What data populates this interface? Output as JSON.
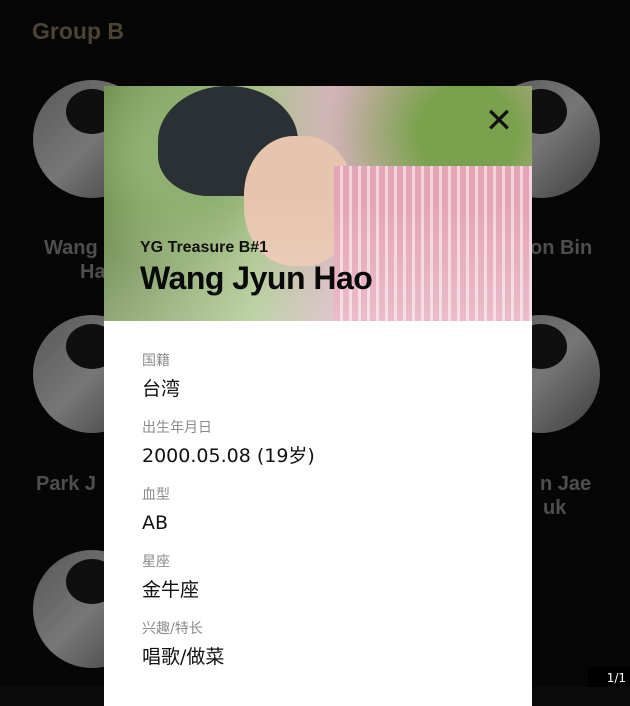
{
  "group": {
    "title": "Group B"
  },
  "background_members": [
    {
      "name_partial": "Wang"
    },
    {
      "name_partial": "Ha"
    },
    {
      "name_partial": "on Bin"
    },
    {
      "name_partial": "Park J"
    },
    {
      "name_partial": "n Jae"
    },
    {
      "name_partial": "uk"
    }
  ],
  "profile": {
    "subtitle": "YG Treasure B#1",
    "name": "Wang Jyun Hao",
    "close_icon": "close-icon",
    "fields": [
      {
        "label": "国籍",
        "value": "台湾"
      },
      {
        "label": "出生年月日",
        "value": "2000.05.08 (19岁)"
      },
      {
        "label": "血型",
        "value": "AB"
      },
      {
        "label": "星座",
        "value": "金牛座"
      },
      {
        "label": "兴趣/特长",
        "value": "唱歌/做菜"
      }
    ]
  },
  "pager": {
    "text": "1/1"
  },
  "colors": {
    "group_title": "#8c7b62",
    "modal_bg": "#ffffff",
    "page_bg": "#0b0b0b"
  }
}
